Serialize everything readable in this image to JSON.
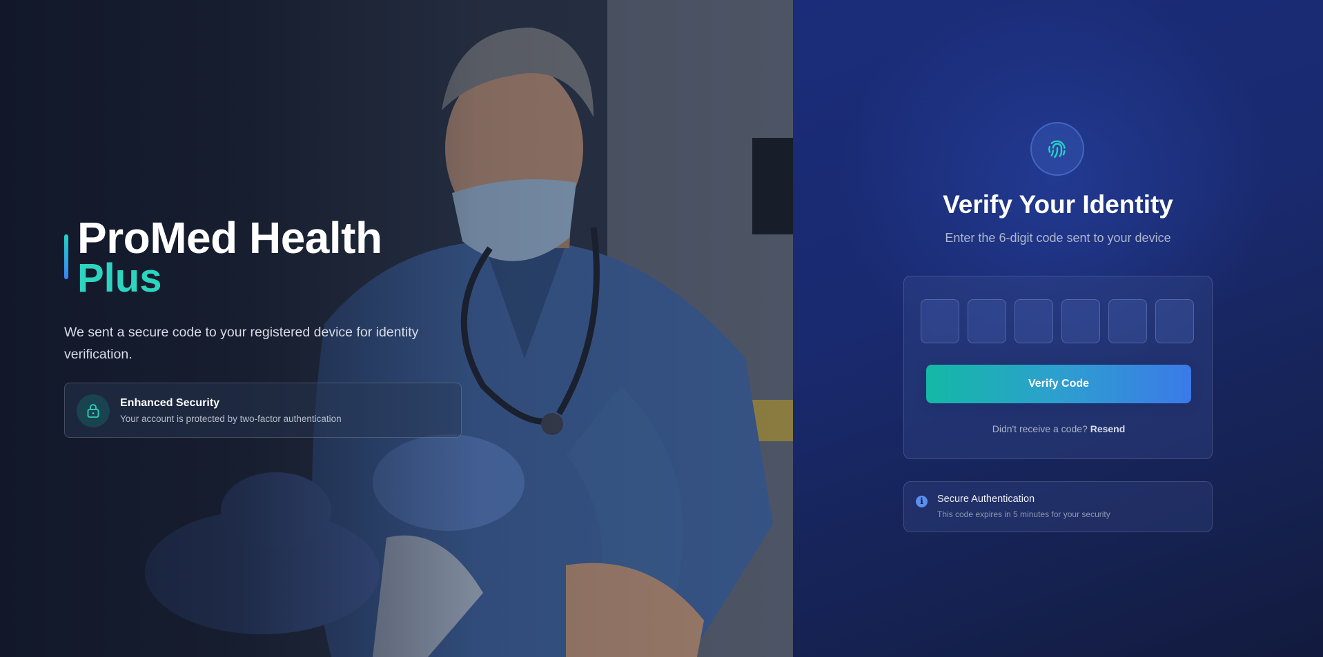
{
  "brand": {
    "name_line1": "ProMed Health",
    "name_line2": "Plus"
  },
  "hero": {
    "description": "We sent a secure code to your registered device for identity verification.",
    "security_card": {
      "title": "Enhanced Security",
      "subtitle": "Your account is protected by two-factor authentication",
      "icon": "lock-icon"
    }
  },
  "verify": {
    "icon": "fingerprint-icon",
    "title": "Verify Your Identity",
    "subtitle": "Enter the 6-digit code sent to your device",
    "code_digits": [
      "",
      "",
      "",
      "",
      "",
      ""
    ],
    "button_label": "Verify Code",
    "resend_prompt": "Didn't receive a code?",
    "resend_link": "Resend"
  },
  "info": {
    "icon": "info-icon",
    "title": "Secure Authentication",
    "subtitle": "This code expires in 5 minutes for your security"
  },
  "colors": {
    "accent_teal": "#2dd4bf",
    "accent_blue": "#3b82f6",
    "panel_bg": "#1b2c7a"
  }
}
